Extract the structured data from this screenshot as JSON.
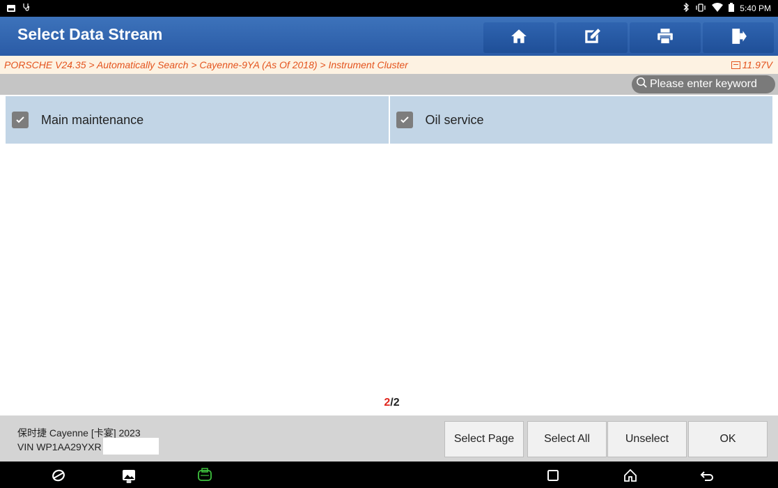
{
  "status_bar": {
    "time": "5:40 PM",
    "left_icons": [
      "image-icon",
      "stethoscope-icon"
    ],
    "right_icons": [
      "bluetooth-icon",
      "vibrate-icon",
      "wifi-icon",
      "battery-icon"
    ]
  },
  "header": {
    "title": "Select Data Stream",
    "tools": [
      "home-icon",
      "edit-icon",
      "print-icon",
      "exit-icon"
    ]
  },
  "breadcrumb": {
    "path": "PORSCHE V24.35 > Automatically Search > Cayenne-9YA (As Of 2018) > Instrument Cluster",
    "voltage": "11.97V"
  },
  "search": {
    "placeholder": "Please enter keyword"
  },
  "items": [
    {
      "label": "Main maintenance",
      "checked": true
    },
    {
      "label": "Oil service",
      "checked": true
    }
  ],
  "pager": {
    "current": "2",
    "separator": "/",
    "total": "2"
  },
  "vehicle": {
    "name": "保时捷 Cayenne [卡宴] 2023",
    "vin": "VIN WP1AA29YXR"
  },
  "buttons": {
    "select_page": "Select Page",
    "select_all": "Select All",
    "unselect": "Unselect",
    "ok": "OK"
  },
  "colors": {
    "header": "#2f62ad",
    "breadcrumb_text": "#e4531d",
    "item_bg": "#c2d5e6",
    "page_current": "#e0261d"
  }
}
